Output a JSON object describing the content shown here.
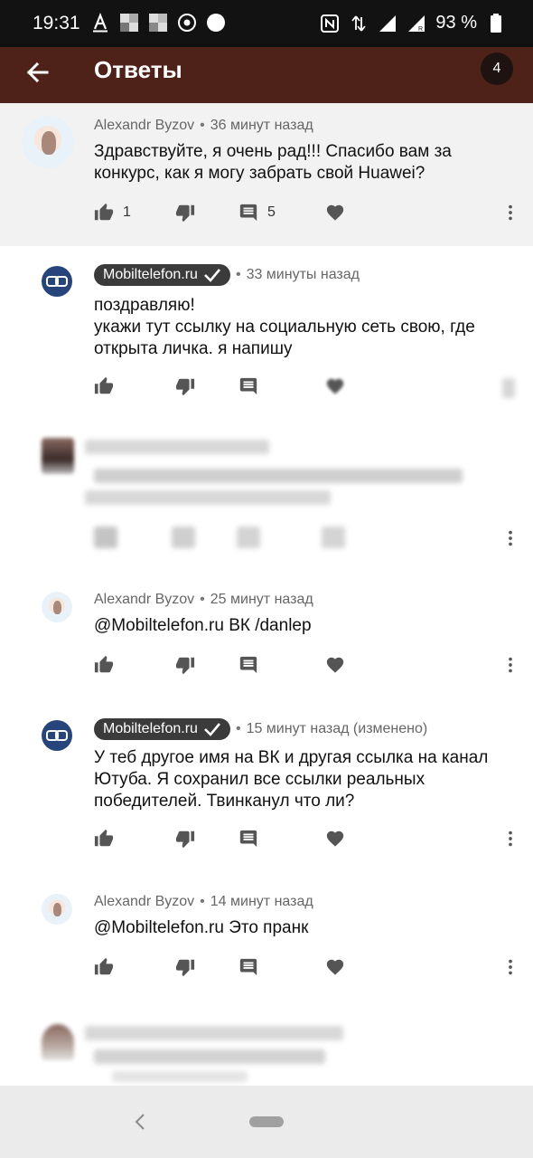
{
  "status_bar": {
    "time": "19:31",
    "battery": "93 %",
    "icons": [
      "text-icon",
      "gallery-icon",
      "gallery-icon",
      "camera-icon",
      "circle-icon",
      "nfc-icon",
      "data-arrows-icon",
      "signal-icon",
      "roaming-signal-icon",
      "battery-icon"
    ]
  },
  "header": {
    "title": "Ответы",
    "count": "4"
  },
  "colors": {
    "appbar": "#4e2219",
    "status_bar": "#121212",
    "channel_chip": "#3b3b3b",
    "highlight_bg": "#f2f2f2"
  },
  "comments": [
    {
      "author": "Alexandr Byzov",
      "time": "36 минут назад",
      "text": "Здравствуйте, я очень рад!!! Спасибо вам за конкурс, как я могу забрать свой Huawei?",
      "likes": "1",
      "replies": "5"
    },
    {
      "author": "Mobiltelefon.ru",
      "verified": true,
      "time": "33 минуты назад",
      "text_lines": [
        "поздравляю!",
        "укажи тут ссылку на социальную сеть свою, где открыта личка. я напишу"
      ]
    },
    {
      "author": "Alexandr Byzov",
      "time": "25 минут назад",
      "text": "@Mobiltelefon.ru ВК /danlep"
    },
    {
      "author": "Mobiltelefon.ru",
      "verified": true,
      "time": "15 минут назад (изменено)",
      "text": "У теб другое имя на ВК и другая ссылка на канал Ютуба. Я сохранил все ссылки реальных победителей. Твинканул что ли?"
    },
    {
      "author": "Alexandr Byzov",
      "time": "14 минут назад",
      "text": "@Mobiltelefon.ru Это пранк"
    }
  ]
}
